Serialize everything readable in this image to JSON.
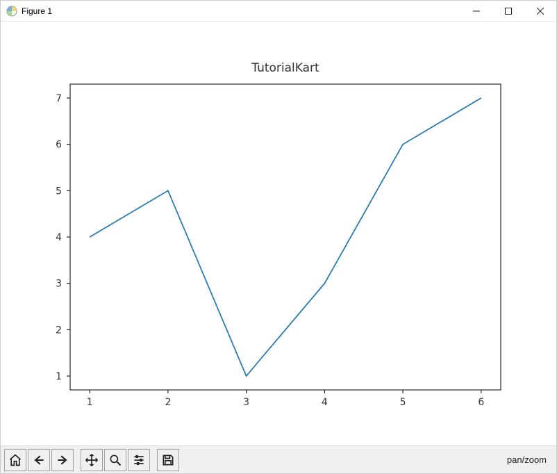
{
  "window": {
    "title": "Figure 1",
    "controls": {
      "minimize": "minimize",
      "maximize": "maximize",
      "close": "close"
    }
  },
  "chart_data": {
    "type": "line",
    "title": "TutorialKart",
    "xlabel": "",
    "ylabel": "",
    "x": [
      1,
      2,
      3,
      4,
      5,
      6
    ],
    "values": [
      4,
      5,
      1,
      3,
      6,
      7
    ],
    "xticks": [
      1,
      2,
      3,
      4,
      5,
      6
    ],
    "yticks": [
      1,
      2,
      3,
      4,
      5,
      6,
      7
    ],
    "xlim": [
      0.75,
      6.25
    ],
    "ylim": [
      0.7,
      7.3
    ],
    "series_color": "#1f77b4"
  },
  "toolbar": {
    "buttons": {
      "home": "Home",
      "back": "Back",
      "forward": "Forward",
      "pan": "Pan",
      "zoom": "Zoom",
      "configure": "Configure subplots",
      "save": "Save figure"
    },
    "status": "pan/zoom"
  }
}
